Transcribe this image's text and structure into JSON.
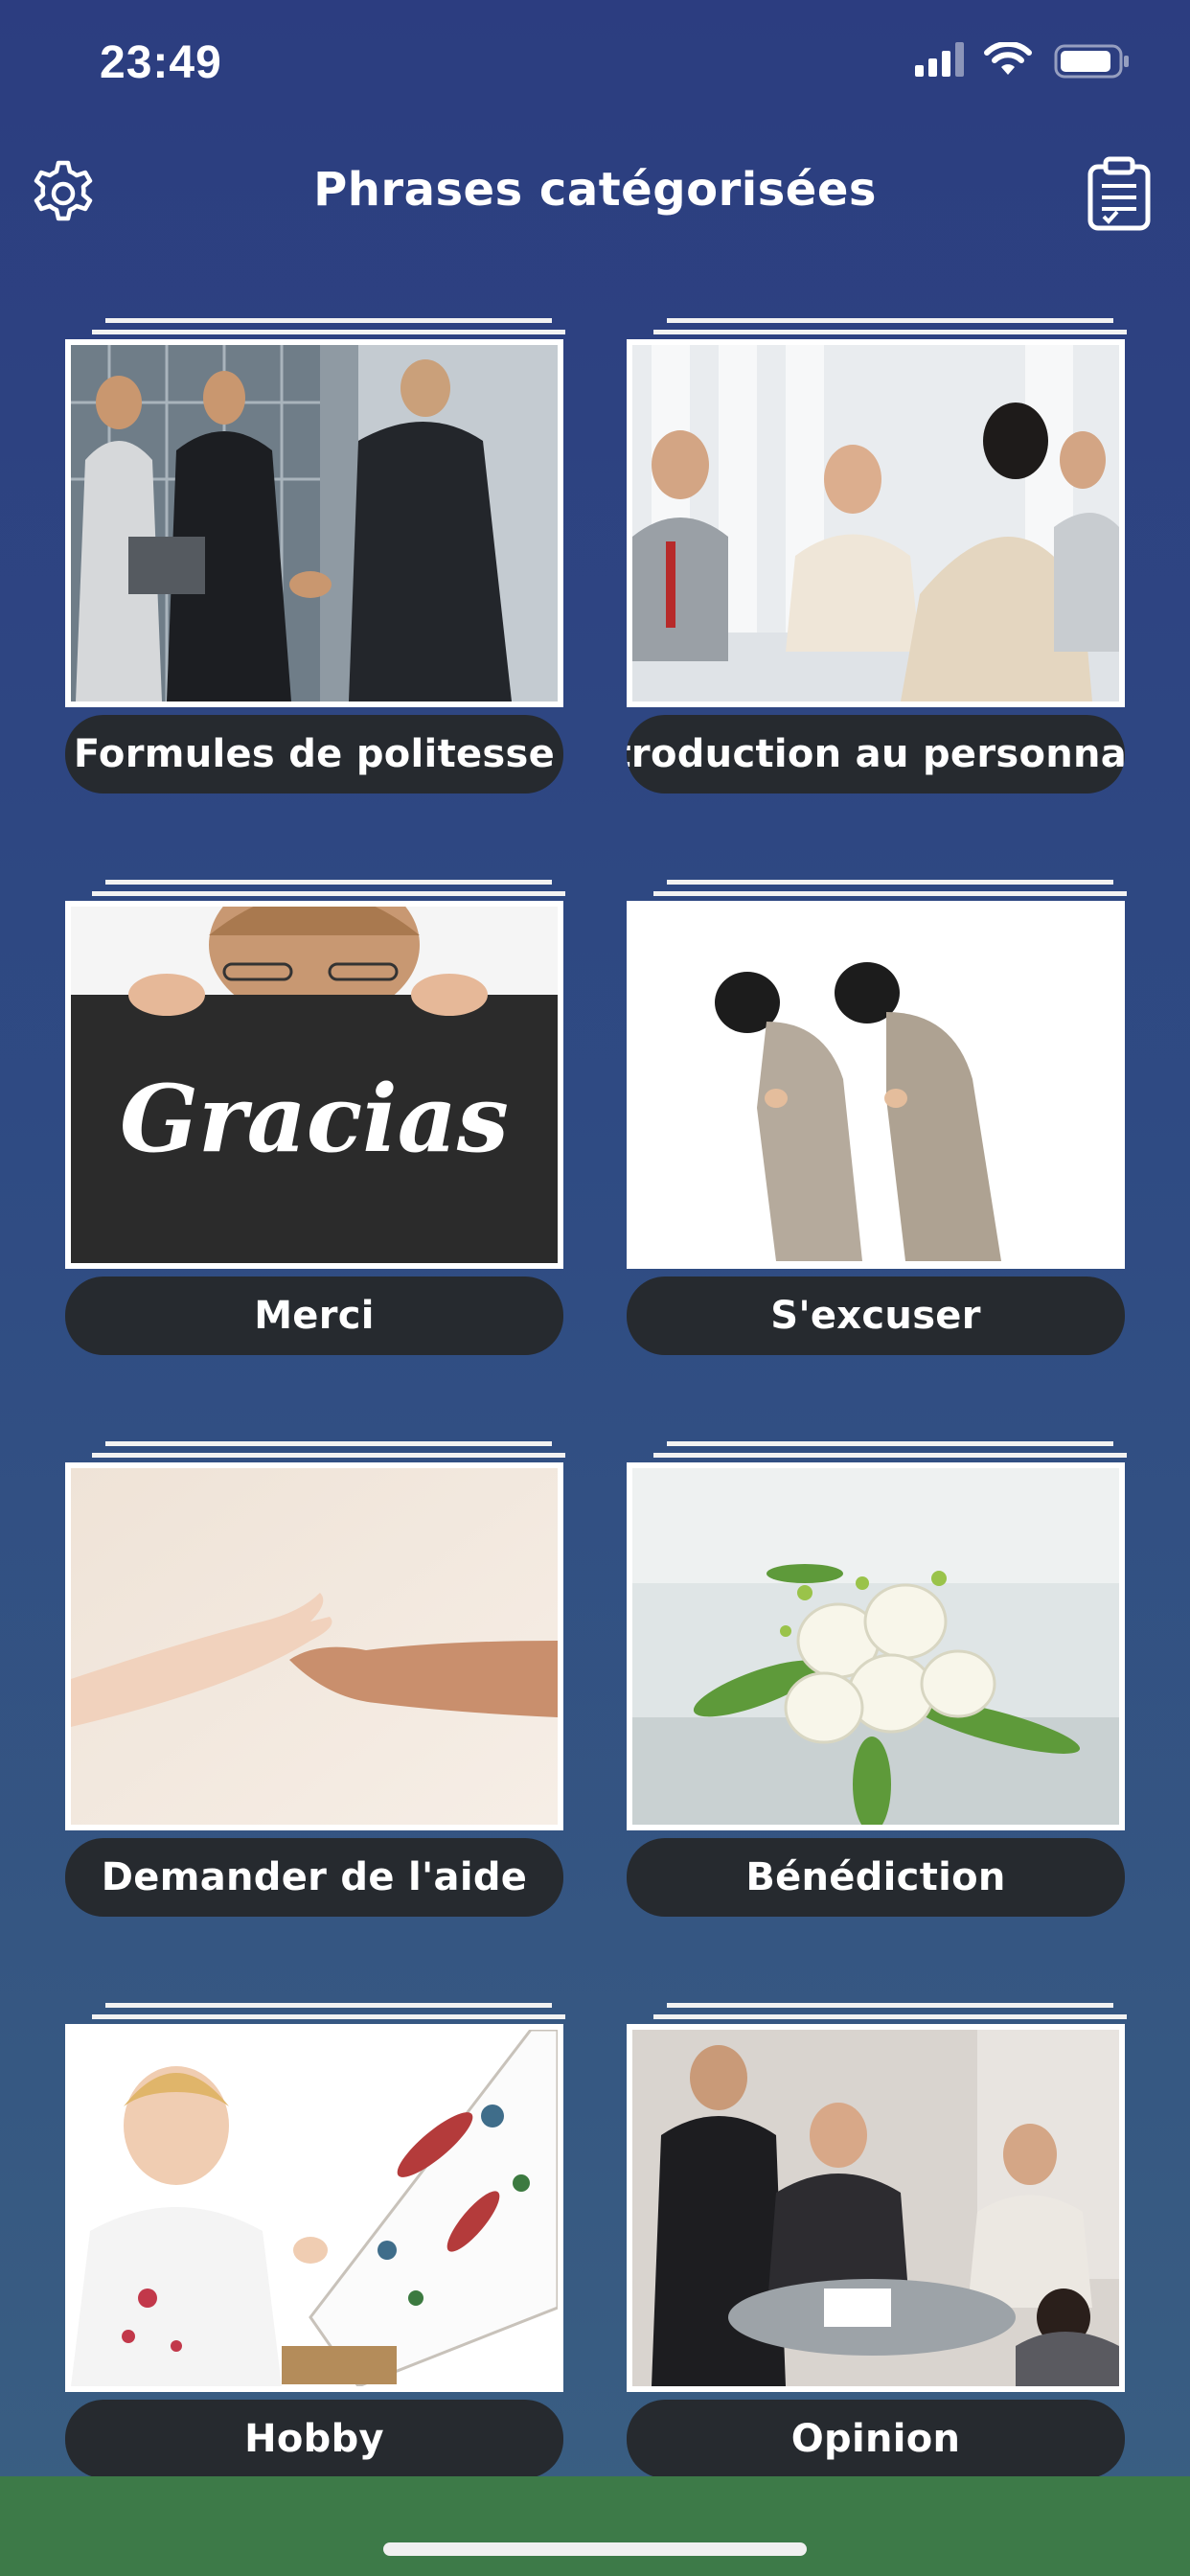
{
  "status": {
    "time": "23:49",
    "icons": [
      "signal-icon",
      "wifi-icon",
      "battery-icon"
    ]
  },
  "header": {
    "title": "Phrases catégorisées",
    "left_icon": "gear-icon",
    "right_icon": "clipboard-check-icon"
  },
  "categories": [
    {
      "label": "Formules de politesse",
      "image": "business-handshake-photo"
    },
    {
      "label": "Introduction au personnage",
      "image": "office-meeting-photo"
    },
    {
      "label": "Merci",
      "image": "gracias-sign-photo",
      "sign_text": "Gracias"
    },
    {
      "label": "S'excuser",
      "image": "bowing-women-photo"
    },
    {
      "label": "Demander de l'aide",
      "image": "reaching-hands-photo"
    },
    {
      "label": "Bénédiction",
      "image": "white-roses-bouquet-photo"
    },
    {
      "label": "Hobby",
      "image": "child-painting-photo"
    },
    {
      "label": "Opinion",
      "image": "business-discussion-photo"
    }
  ],
  "colors": {
    "background_top": "#2c3d80",
    "background_bottom": "#3a5f82",
    "label_bg": "#262a2f",
    "bottom_bar": "#3d7a48"
  }
}
